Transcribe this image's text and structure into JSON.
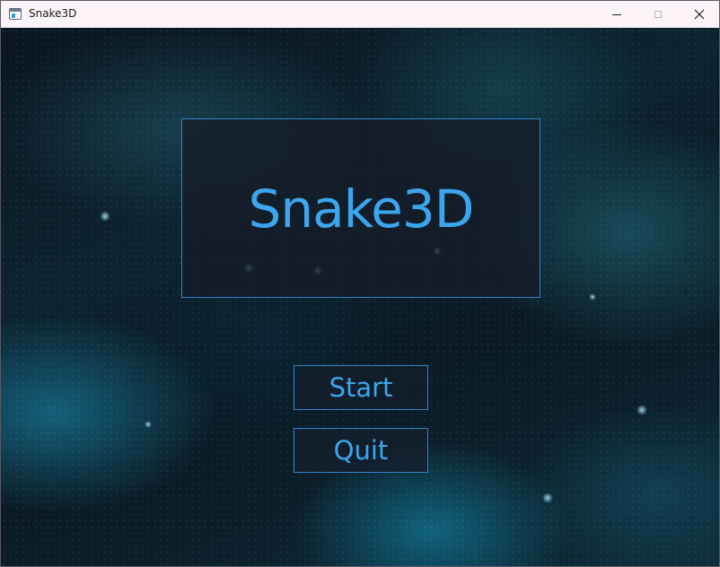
{
  "window": {
    "title": "Snake3D",
    "icon": "app-window-icon"
  },
  "title_bar_controls": {
    "minimize_icon": "minimize-icon",
    "maximize_icon": "maximize-icon",
    "close_icon": "close-icon",
    "close_glyph": "✕"
  },
  "main_menu": {
    "game_title": "Snake3D",
    "start_label": "Start",
    "quit_label": "Quit"
  },
  "colors": {
    "accent": "#3ba6ee",
    "panel_border": "#2f86c8",
    "titlebar_bg": "#fbf3f8"
  }
}
